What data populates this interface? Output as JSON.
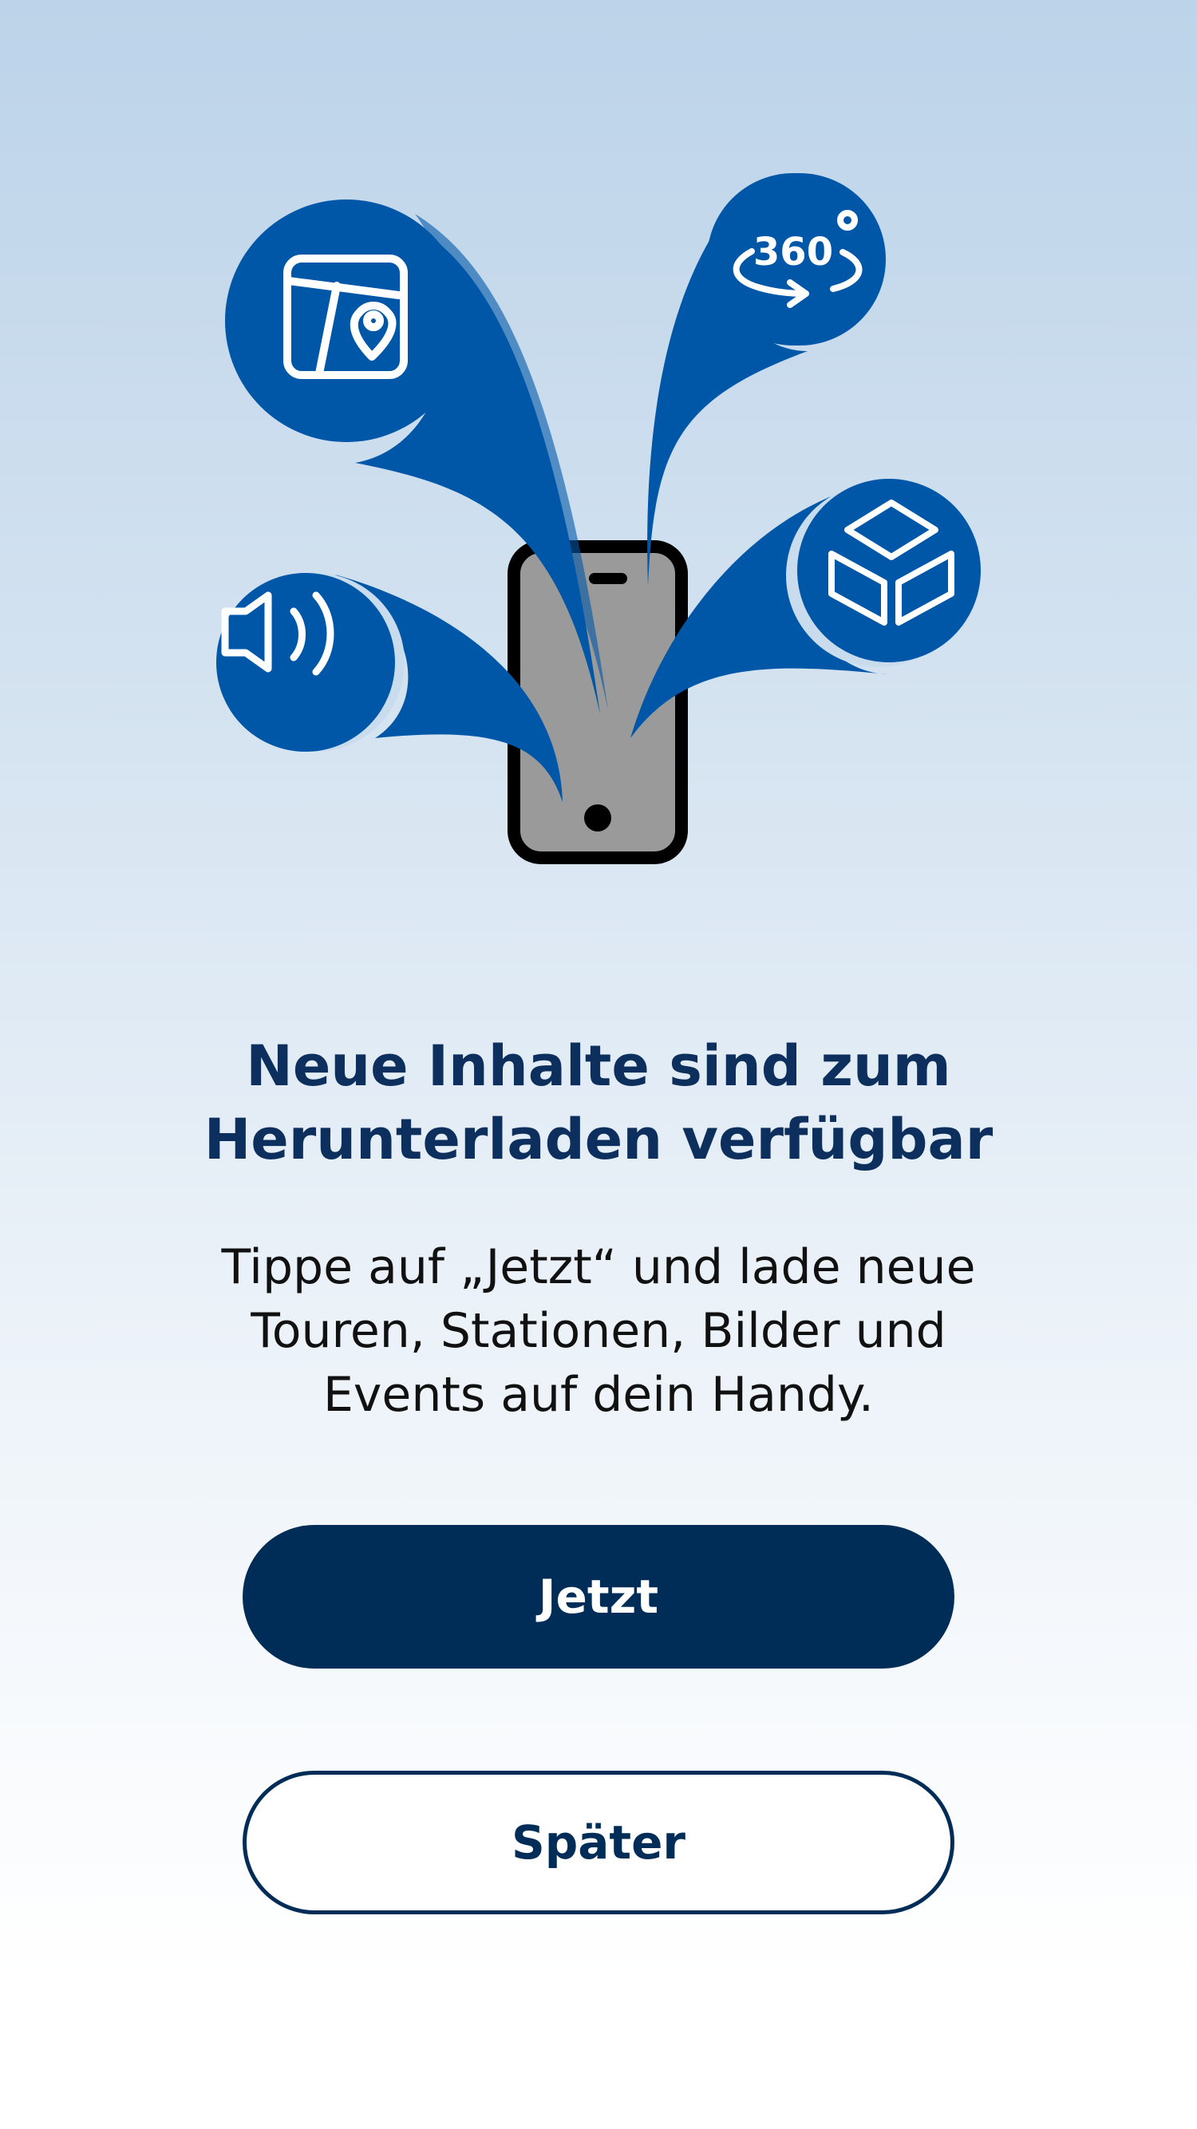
{
  "colors": {
    "brand_blue": "#0057a8",
    "navy": "#002c58",
    "title": "#0c2f5e",
    "phone_screen": "#9a9a9a"
  },
  "illustration": {
    "icons": [
      "map-pin-icon",
      "360-view-icon",
      "3d-cube-icon",
      "speaker-icon"
    ],
    "badge_360_text": "360"
  },
  "dialog": {
    "title_line1": "Neue Inhalte sind zum",
    "title_line2": "Herunterladen verfügbar",
    "description_line1": "Tippe auf „Jetzt“ und lade neue",
    "description_line2": "Touren, Stationen, Bilder und",
    "description_line3": "Events auf dein Handy.",
    "primary_button": "Jetzt",
    "secondary_button": "Später"
  }
}
